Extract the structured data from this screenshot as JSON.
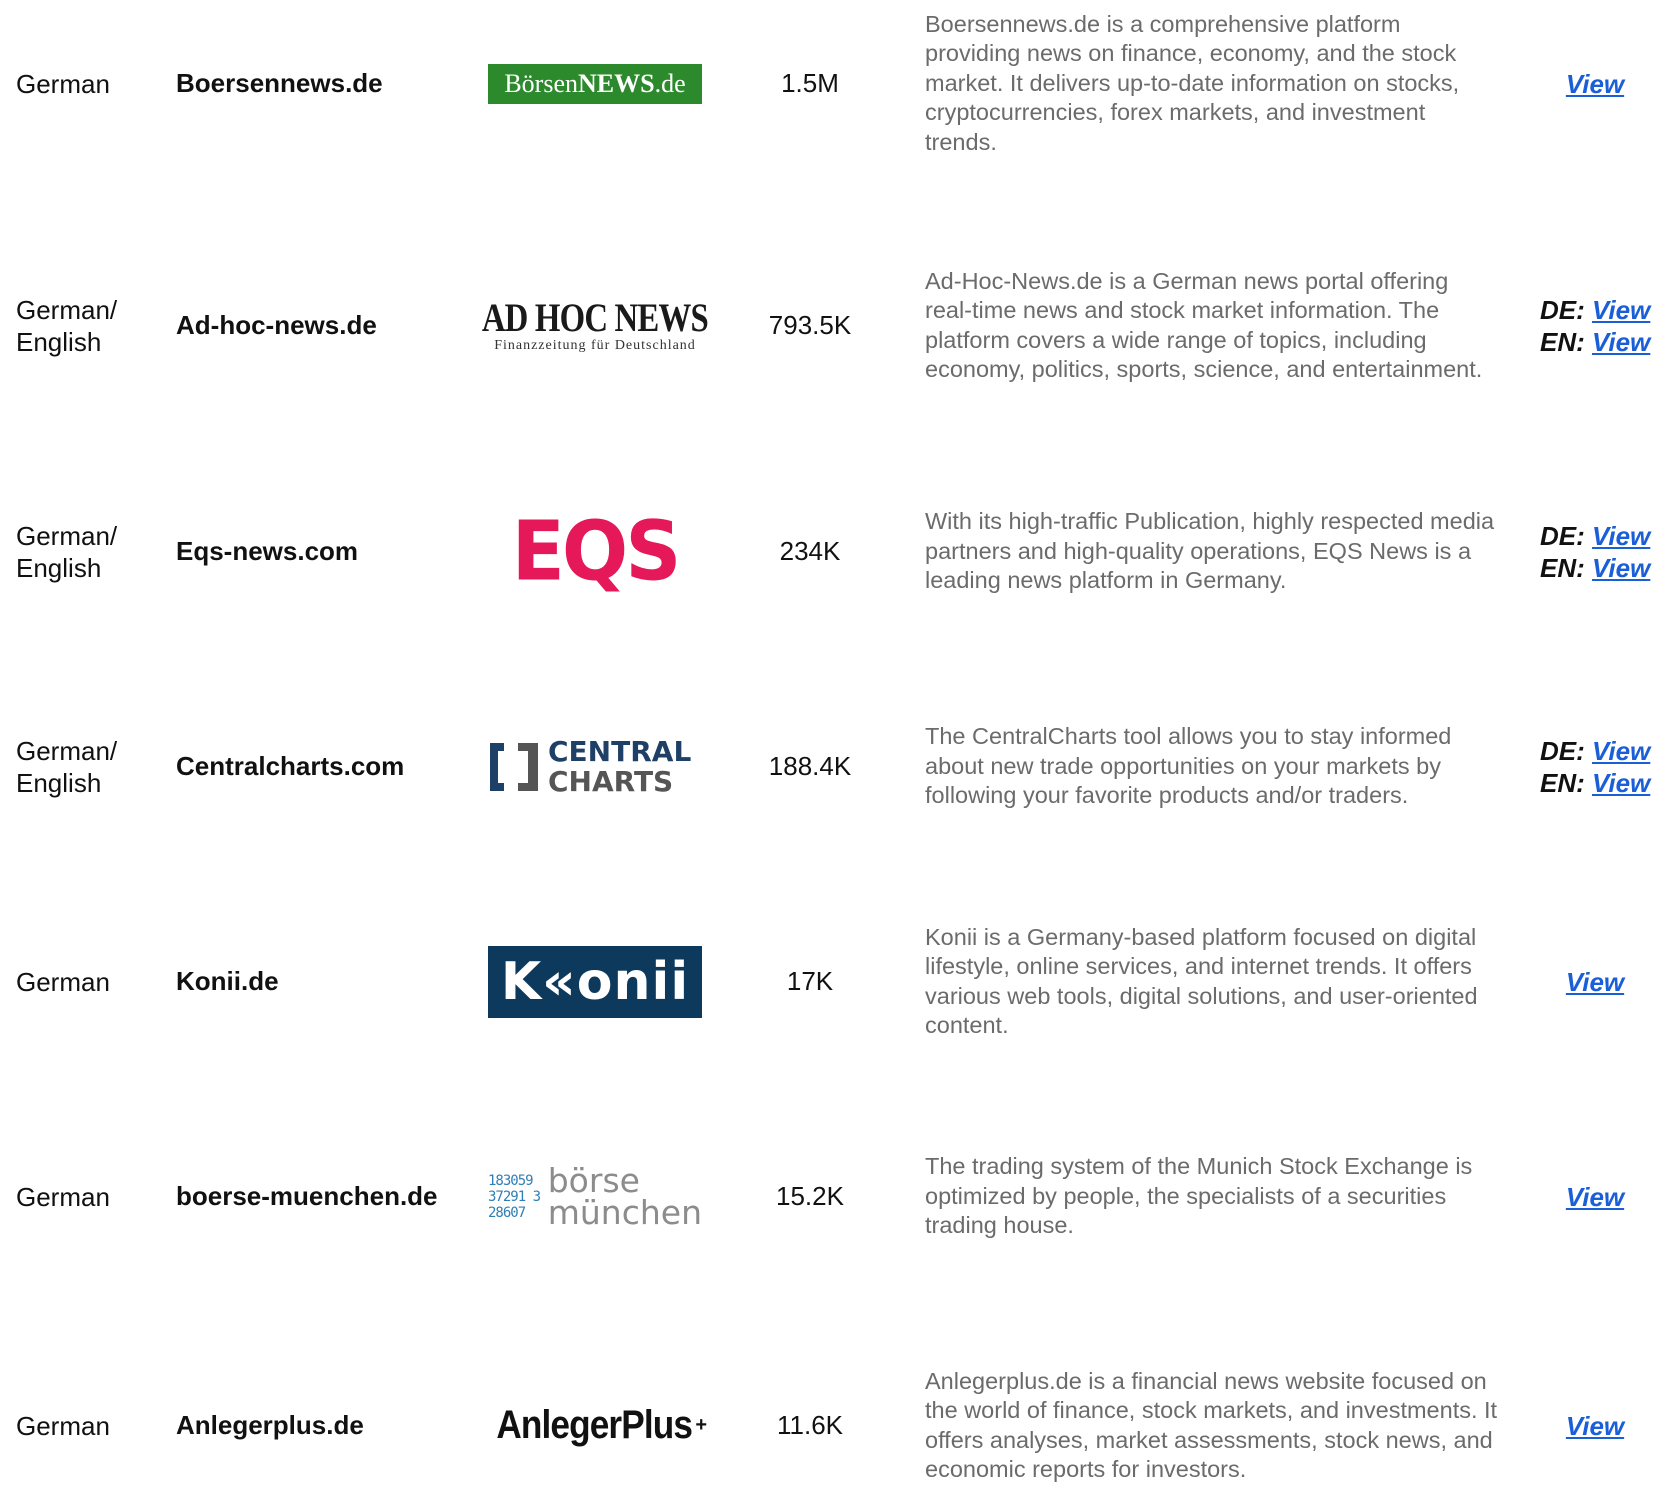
{
  "rows": [
    {
      "language": "German",
      "site": "Boersennews.de",
      "logo": {
        "icon": "boersennews-logo",
        "text_a": "Börsen",
        "text_b": "NEWS",
        "text_c": ".de",
        "bg": "#2c8a2c"
      },
      "traffic": "1.5M",
      "description": "Boersennews.de is a comprehensive platform providing news on finance, economy, and the stock market. It delivers up-to-date information on stocks, cryptocurrencies, forex markets, and investment trends.",
      "links": [
        {
          "prefix": "",
          "label": "View"
        }
      ]
    },
    {
      "language": "German/ English",
      "site": "Ad-hoc-news.de",
      "logo": {
        "icon": "adhocnews-logo",
        "title": "AD HOC NEWS",
        "tagline": "Finanzzeitung für Deutschland"
      },
      "traffic": "793.5K",
      "description": "Ad-Hoc-News.de is a German news portal offering real-time news and stock market information. The platform covers a wide range of topics, including economy, politics, sports, science, and entertainment.",
      "links": [
        {
          "prefix": "DE: ",
          "label": "View"
        },
        {
          "prefix": "EN: ",
          "label": "View"
        }
      ]
    },
    {
      "language": "German/ English",
      "site": "Eqs-news.com",
      "logo": {
        "icon": "eqs-logo",
        "text": "EQS",
        "color": "#e5195a"
      },
      "traffic": "234K",
      "description": "With its high-traffic Publication, highly respected media partners and high-quality operations, EQS News is a leading news platform in Germany.",
      "links": [
        {
          "prefix": "DE: ",
          "label": "View"
        },
        {
          "prefix": "EN: ",
          "label": "View"
        }
      ]
    },
    {
      "language": "German/ English",
      "site": "Centralcharts.com",
      "logo": {
        "icon": "centralcharts-logo",
        "line1": "CENTRAL",
        "line2": "CHARTS"
      },
      "traffic": "188.4K",
      "description": "The CentralCharts tool allows you to stay informed about new trade opportunities on your markets by following your favorite products and/or traders.",
      "links": [
        {
          "prefix": "DE: ",
          "label": "View"
        },
        {
          "prefix": "EN: ",
          "label": "View"
        }
      ]
    },
    {
      "language": "German",
      "site": "Konii.de",
      "logo": {
        "icon": "konii-logo",
        "text": "K«onii",
        "bg": "#0d3a5c"
      },
      "traffic": "17K",
      "description": "Konii is a Germany-based platform focused on digital lifestyle, online services, and internet trends. It offers various web tools, digital solutions, and user-oriented content.",
      "links": [
        {
          "prefix": "",
          "label": "View"
        }
      ]
    },
    {
      "language": "German",
      "site": "boerse-muenchen.de",
      "logo": {
        "icon": "boerse-muenchen-logo",
        "line1": "börse",
        "line2": "münchen",
        "digits": "183059 37291 328607"
      },
      "traffic": "15.2K",
      "description": "The trading system of the Munich Stock Exchange is optimized by people, the specialists of a securities trading house.",
      "links": [
        {
          "prefix": "",
          "label": "View"
        }
      ]
    },
    {
      "language": "German",
      "site": "Anlegerplus.de",
      "logo": {
        "icon": "anlegerplus-logo",
        "text": "AnlegerPlus",
        "sup": "+"
      },
      "traffic": "11.6K",
      "description": "Anlegerplus.de is a financial news website focused on the world of finance, stock markets, and investments. It offers analyses, market assessments, stock news, and economic reports for investors.",
      "links": [
        {
          "prefix": "",
          "label": "View"
        }
      ]
    }
  ],
  "colors": {
    "link": "#1a5fd8",
    "description": "#6b6b6b",
    "text": "#111111"
  }
}
